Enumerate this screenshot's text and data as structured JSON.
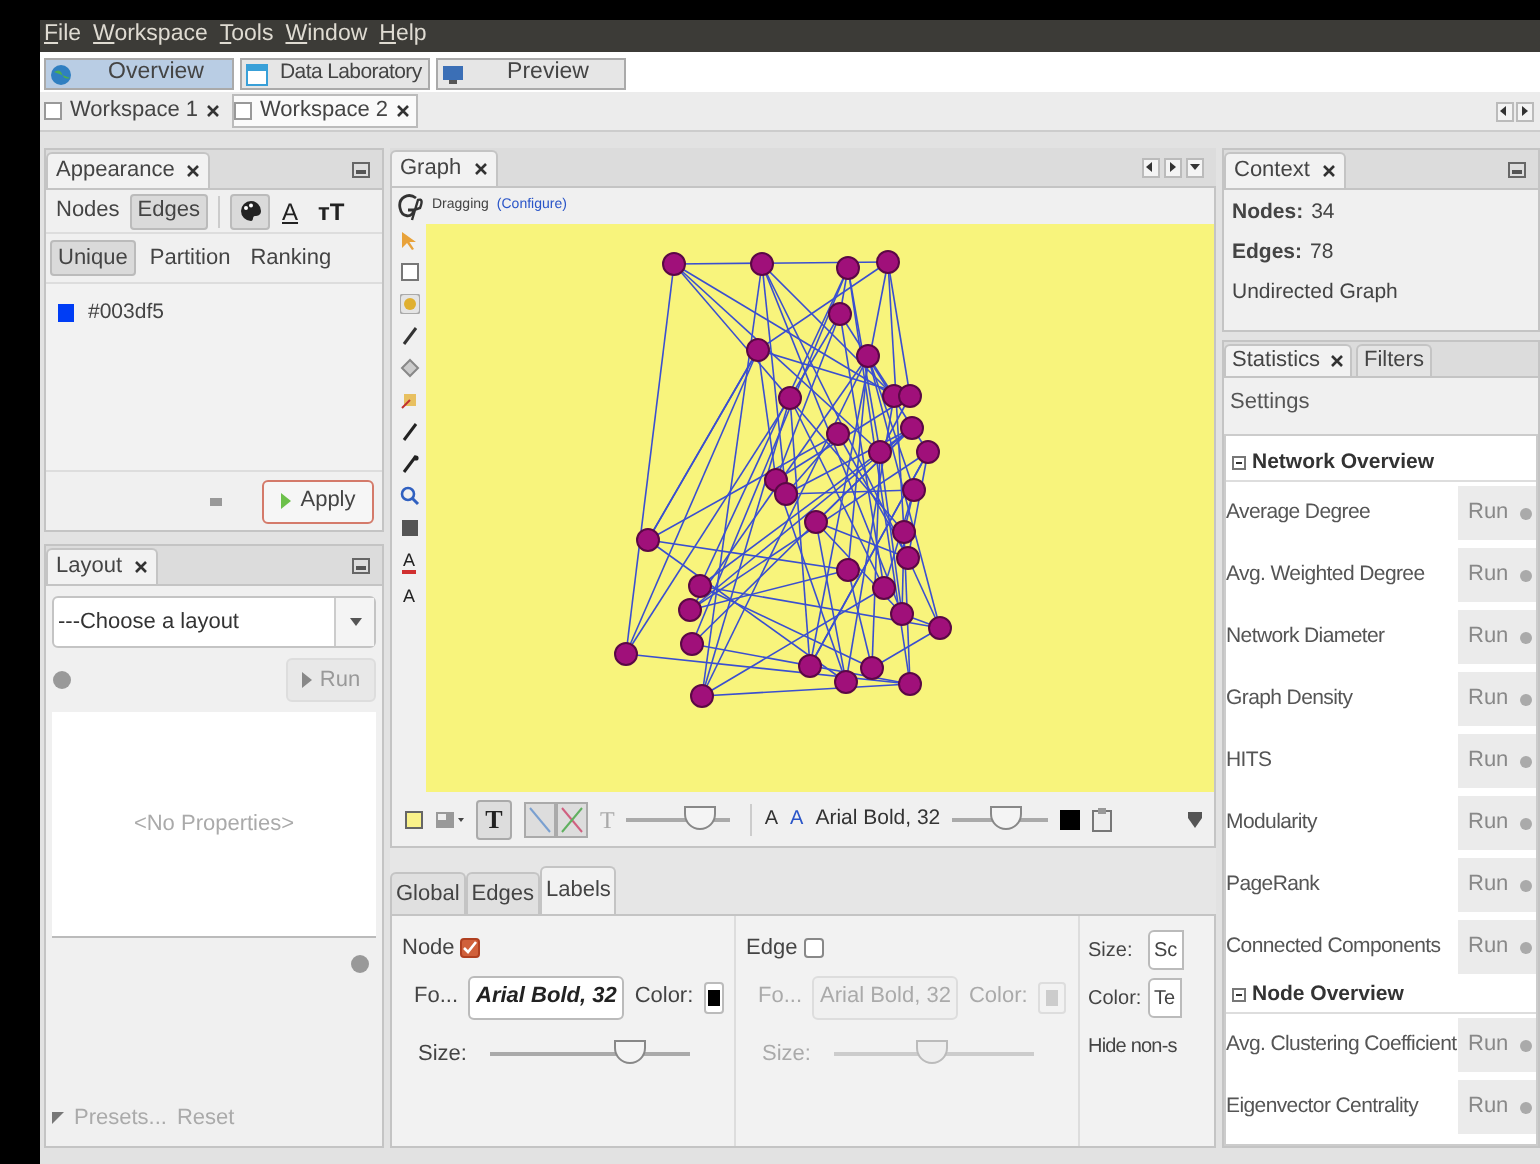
{
  "menu": [
    "File",
    "Workspace",
    "Tools",
    "Window",
    "Help"
  ],
  "main_tabs": [
    {
      "label": "Overview",
      "selected": true
    },
    {
      "label": "Data Laboratory",
      "selected": false
    },
    {
      "label": "Preview",
      "selected": false
    }
  ],
  "workspaces": [
    {
      "label": "Workspace 1",
      "selected": false
    },
    {
      "label": "Workspace 2",
      "selected": true
    }
  ],
  "appearance": {
    "title": "Appearance",
    "element_tabs": [
      {
        "label": "Nodes",
        "selected": false
      },
      {
        "label": "Edges",
        "selected": true
      }
    ],
    "attribute_letters": [
      "A",
      "тT"
    ],
    "method_tabs": [
      {
        "label": "Unique",
        "selected": true
      },
      {
        "label": "Partition",
        "selected": false
      },
      {
        "label": "Ranking",
        "selected": false
      }
    ],
    "color": "#003df5",
    "color_text": "#003df5",
    "apply": "Apply"
  },
  "layout": {
    "title": "Layout",
    "select": "---Choose a layout",
    "run": "Run",
    "empty": "<No Properties>",
    "presets": "Presets...",
    "reset": "Reset"
  },
  "graph": {
    "title": "Graph",
    "mode": "Dragging",
    "configure": "(Configure)",
    "side_letters": [
      "A",
      "A"
    ],
    "toolbar": {
      "text_buttons": [
        "T",
        "T"
      ],
      "size_slider": {
        "level": 0.7
      },
      "font_size_buttons": [
        "A",
        "A"
      ],
      "font": "Arial Bold, 32",
      "font_slider": {
        "level": 0.55
      }
    },
    "tabs": [
      {
        "label": "Global",
        "selected": false
      },
      {
        "label": "Edges",
        "selected": false
      },
      {
        "label": "Labels",
        "selected": true
      }
    ],
    "node_labels": {
      "label": "Node",
      "checked": true,
      "font_label": "Fo...",
      "font": "Arial Bold, 32",
      "color_label": "Color:",
      "size_label": "Size:",
      "level": 0.7
    },
    "edge_labels": {
      "label": "Edge",
      "checked": false,
      "font_label": "Fo...",
      "font": "Arial Bold, 32",
      "color_label": "Color:",
      "size_label": "Size:",
      "level": 0.49
    },
    "other": {
      "size_label": "Size:",
      "size_value": "Sc",
      "color_label": "Color:",
      "color_value": "Te",
      "hide": "Hide non-s"
    }
  },
  "context": {
    "title": "Context",
    "nodes_label": "Nodes:",
    "nodes": "34",
    "edges_label": "Edges:",
    "edges": "78",
    "type": "Undirected Graph"
  },
  "statistics": {
    "tabs": [
      {
        "label": "Statistics",
        "selected": true
      },
      {
        "label": "Filters",
        "selected": false
      }
    ],
    "settings": "Settings",
    "sections": [
      {
        "title": "Network Overview",
        "items": [
          {
            "label": "Average Degree",
            "run": "Run"
          },
          {
            "label": "Avg. Weighted Degree",
            "run": "Run"
          },
          {
            "label": "Network Diameter",
            "run": "Run"
          },
          {
            "label": "Graph Density",
            "run": "Run"
          },
          {
            "label": "HITS",
            "run": "Run"
          },
          {
            "label": "Modularity",
            "run": "Run"
          },
          {
            "label": "PageRank",
            "run": "Run"
          },
          {
            "label": "Connected Components",
            "run": "Run"
          }
        ]
      },
      {
        "title": "Node Overview",
        "items": [
          {
            "label": "Avg. Clustering Coefficient",
            "run": "Run"
          },
          {
            "label": "Eigenvector Centrality",
            "run": "Run"
          }
        ]
      }
    ]
  }
}
